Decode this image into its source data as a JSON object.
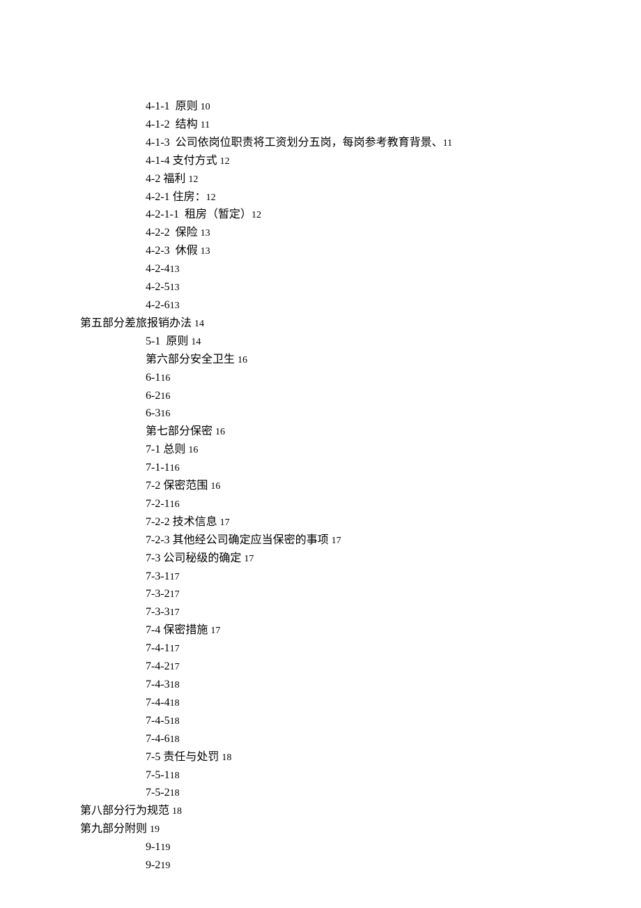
{
  "lines": [
    {
      "indent": 1,
      "text": "4-1-1  原则 ",
      "page": "10"
    },
    {
      "indent": 1,
      "text": "4-1-2  结构 ",
      "page": "11"
    },
    {
      "indent": 1,
      "text": "4-1-3  公司依岗位职责将工资划分五岗，每岗参考教育背景、",
      "page": "11"
    },
    {
      "indent": 1,
      "text": "4-1-4 支付方式 ",
      "page": "12"
    },
    {
      "indent": 1,
      "text": "4-2 福利 ",
      "page": "12"
    },
    {
      "indent": 1,
      "text": "4-2-1 住房：",
      "page": "12"
    },
    {
      "indent": 1,
      "text": "4-2-1-1  租房（暂定）",
      "page": "12"
    },
    {
      "indent": 1,
      "text": "4-2-2  保险 ",
      "page": "13"
    },
    {
      "indent": 1,
      "text": "4-2-3  休假 ",
      "page": "13"
    },
    {
      "indent": 1,
      "text": "4-2-4",
      "page": "13"
    },
    {
      "indent": 1,
      "text": "4-2-5",
      "page": "13"
    },
    {
      "indent": 1,
      "text": "4-2-6",
      "page": "13"
    },
    {
      "indent": 0,
      "text": "第五部分差旅报销办法 ",
      "page": "14"
    },
    {
      "indent": 1,
      "text": "5-1  原则 ",
      "page": "14"
    },
    {
      "indent": 1,
      "text": "第六部分安全卫生 ",
      "page": "16"
    },
    {
      "indent": 1,
      "text": "6-1",
      "page": "16"
    },
    {
      "indent": 1,
      "text": "6-2",
      "page": "16"
    },
    {
      "indent": 1,
      "text": "6-3",
      "page": "16"
    },
    {
      "indent": 1,
      "text": "第七部分保密 ",
      "page": "16"
    },
    {
      "indent": 1,
      "text": "7-1 总则 ",
      "page": "16"
    },
    {
      "indent": 1,
      "text": "7-1-1",
      "page": "16"
    },
    {
      "indent": 1,
      "text": "7-2 保密范围 ",
      "page": "16"
    },
    {
      "indent": 1,
      "text": "7-2-1",
      "page": "16"
    },
    {
      "indent": 1,
      "text": "7-2-2 技术信息 ",
      "page": "17"
    },
    {
      "indent": 1,
      "text": "7-2-3 其他经公司确定应当保密的事项 ",
      "page": "17"
    },
    {
      "indent": 1,
      "text": "7-3 公司秘级的确定 ",
      "page": "17"
    },
    {
      "indent": 1,
      "text": "7-3-1",
      "page": "17"
    },
    {
      "indent": 1,
      "text": "7-3-2",
      "page": "17"
    },
    {
      "indent": 1,
      "text": "7-3-3",
      "page": "17"
    },
    {
      "indent": 1,
      "text": "7-4 保密措施 ",
      "page": "17"
    },
    {
      "indent": 1,
      "text": "7-4-1",
      "page": "17"
    },
    {
      "indent": 1,
      "text": "7-4-2",
      "page": "17"
    },
    {
      "indent": 1,
      "text": "7-4-3",
      "page": "18"
    },
    {
      "indent": 1,
      "text": "7-4-4",
      "page": "18"
    },
    {
      "indent": 1,
      "text": "7-4-5",
      "page": "18"
    },
    {
      "indent": 1,
      "text": "7-4-6",
      "page": "18"
    },
    {
      "indent": 1,
      "text": "7-5 责任与处罚 ",
      "page": "18"
    },
    {
      "indent": 1,
      "text": "7-5-1",
      "page": "18"
    },
    {
      "indent": 1,
      "text": "7-5-2",
      "page": "18"
    },
    {
      "indent": 0,
      "text": "第八部分行为规范 ",
      "page": "18"
    },
    {
      "indent": 0,
      "text": "第九部分附则 ",
      "page": "19"
    },
    {
      "indent": 1,
      "text": "9-1",
      "page": "19"
    },
    {
      "indent": 1,
      "text": "9-2",
      "page": "19"
    }
  ]
}
